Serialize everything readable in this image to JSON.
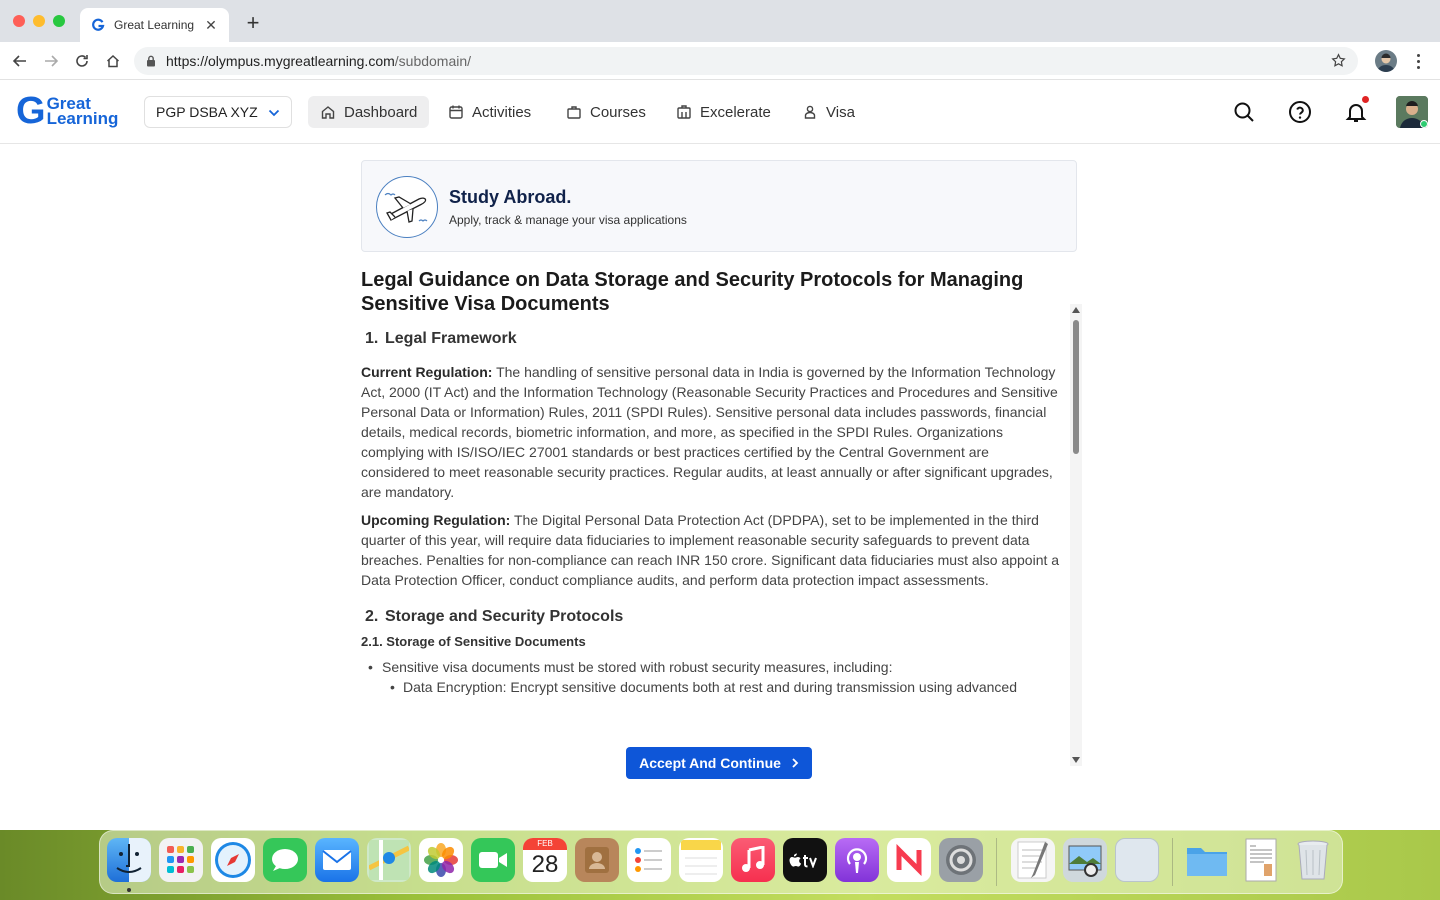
{
  "browser": {
    "tab_title": "Great Learning",
    "url_host": "https://olympus.mygreatlearning.com",
    "url_path": "/subdomain/"
  },
  "header": {
    "logo_line1": "Great",
    "logo_line2": "Learning",
    "program": "PGP DSBA XYZ",
    "nav": [
      {
        "label": "Dashboard",
        "icon": "home-icon",
        "active": true
      },
      {
        "label": "Activities",
        "icon": "calendar-icon"
      },
      {
        "label": "Courses",
        "icon": "briefcase-icon"
      },
      {
        "label": "Excelerate",
        "icon": "building-icon"
      },
      {
        "label": "Visa",
        "icon": "person-icon"
      }
    ]
  },
  "study_card": {
    "title": "Study Abroad.",
    "subtitle": "Apply, track & manage your visa applications"
  },
  "document": {
    "title": "Legal Guidance on Data Storage and Security Protocols for Managing Sensitive Visa Documents",
    "s1_num": "1.",
    "s1_title": "Legal Framework",
    "p1_label": "Current Regulation:",
    "p1_text": " The handling of sensitive personal data in India is governed by the Information Technology Act, 2000 (IT Act) and the Information Technology (Reasonable Security Practices and Procedures and Sensitive Personal Data or Information) Rules, 2011 (SPDI Rules). Sensitive personal data includes passwords, financial details, medical records, biometric information, and more, as specified in the SPDI Rules. Organizations complying with IS/ISO/IEC 27001 standards or best practices certified by the Central Government are considered to meet reasonable security practices. Regular audits, at least annually or after significant upgrades, are mandatory.",
    "p2_label": "Upcoming Regulation:",
    "p2_text": " The Digital Personal Data Protection Act (DPDPA), set to be implemented in the third quarter of this year, will require data fiduciaries to implement reasonable security safeguards to prevent data breaches. Penalties for non-compliance can reach INR 150 crore. Significant data fiduciaries must also appoint a Data Protection Officer, conduct compliance audits, and perform data protection impact assessments.",
    "s2_num": "2.",
    "s2_title": "Storage and Security Protocols",
    "s21_title": "2.1. Storage of Sensitive Documents",
    "bullet1": "Sensitive visa documents must be stored with robust security measures, including:",
    "bullet2": "Data Encryption: Encrypt sensitive documents both at rest and during transmission using advanced"
  },
  "accept_button": "Accept And Continue",
  "dock": {
    "calendar_month": "FEB",
    "calendar_day": "28",
    "apps": [
      "Finder",
      "Launchpad",
      "Safari",
      "Messages",
      "Mail",
      "Maps",
      "Photos",
      "FaceTime",
      "Calendar",
      "Contacts",
      "Reminders",
      "Notes",
      "Music",
      "TV",
      "Podcasts",
      "News",
      "System Settings",
      "TextEdit",
      "Preview",
      "Blank",
      "Folder",
      "Document",
      "Trash"
    ]
  }
}
